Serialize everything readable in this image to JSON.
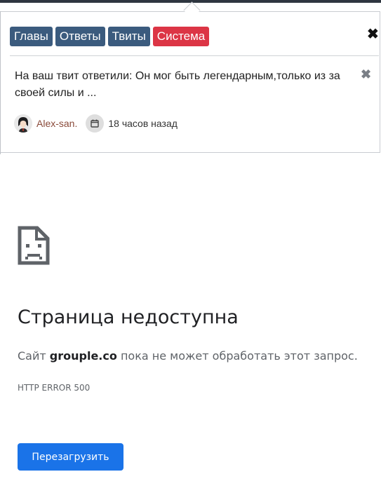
{
  "notification_popup": {
    "tabs": [
      {
        "label": "Главы"
      },
      {
        "label": "Ответы"
      },
      {
        "label": "Твиты"
      },
      {
        "label": "Система"
      }
    ],
    "close_symbol": "✖",
    "item": {
      "text": "На ваш твит ответили: Он мог быть легендарным,только из за своей силы и ...",
      "dismiss_symbol": "✖",
      "author": "Alex-san.",
      "time": "18 часов назад",
      "avatar_icon": "user-avatar",
      "time_icon": "calendar-icon"
    },
    "colors": {
      "tab_primary": "#3b5b7e",
      "tab_danger": "#dc3545"
    }
  },
  "error_page": {
    "icon": "sad-document-icon",
    "title": "Страница недоступна",
    "desc_prefix": "Сайт ",
    "site": "grouple.co",
    "desc_suffix": " пока не может обработать этот запрос.",
    "code": "HTTP ERROR 500",
    "reload_label": "Перезагрузить",
    "colors": {
      "button": "#1a73e8"
    }
  }
}
